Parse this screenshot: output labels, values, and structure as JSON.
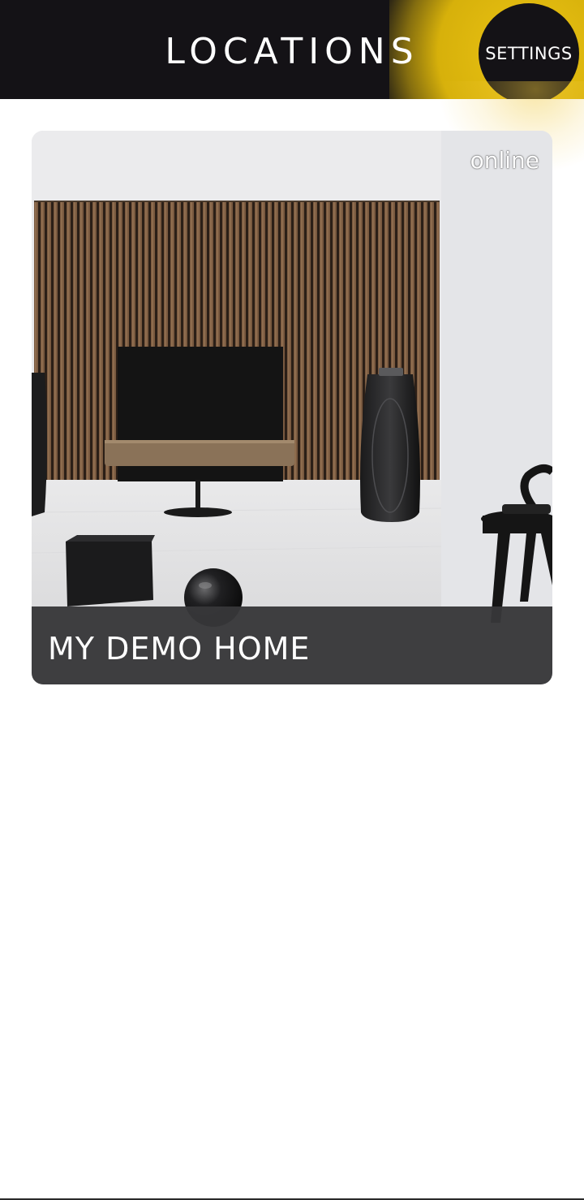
{
  "header": {
    "title": "LOCATIONS",
    "settings_label": "SETTINGS",
    "accent_color": "#E1B90A",
    "background_color": "#141216"
  },
  "locations": [
    {
      "name": "MY DEMO HOME",
      "status": "online",
      "image": "living-room-tv-speakers-photo"
    }
  ]
}
